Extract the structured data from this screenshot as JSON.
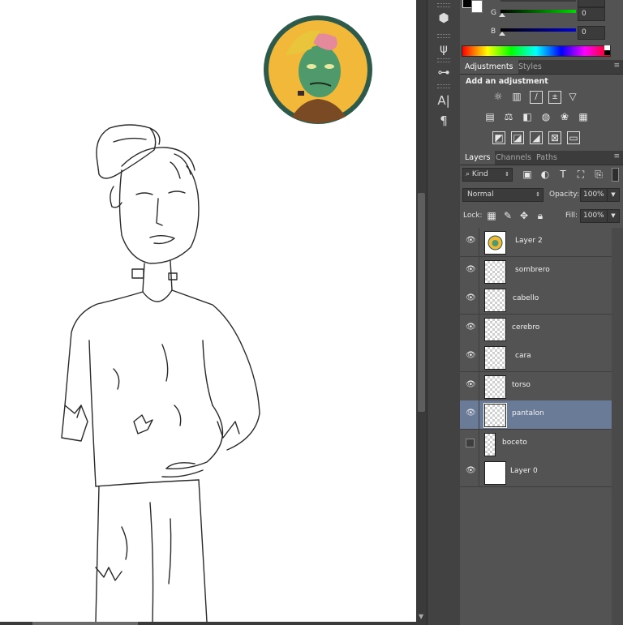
{
  "color_panel": {
    "g_label": "G",
    "g_value": "0",
    "b_label": "B",
    "b_value": "0",
    "g_color": "#00d800",
    "b_color": "#0000d8"
  },
  "adjustments": {
    "tab_adjustments": "Adjustments",
    "tab_styles": "Styles",
    "heading": "Add an adjustment",
    "icons": [
      "brightness-icon",
      "levels-icon",
      "curves-icon",
      "exposure-icon",
      "vibrance-icon",
      "hue-saturation-icon",
      "color-balance-icon",
      "black-white-icon",
      "photo-filter-icon",
      "channel-mixer-icon",
      "color-lookup-icon",
      "invert-icon",
      "posterize-icon",
      "threshold-icon",
      "selective-color-icon",
      "gradient-map-icon"
    ]
  },
  "layers_panel": {
    "tab_layers": "Layers",
    "tab_channels": "Channels",
    "tab_paths": "Paths",
    "filter_kind": "Kind",
    "blend_mode": "Normal",
    "opacity_label": "Opacity:",
    "opacity_value": "100%",
    "lock_label": "Lock:",
    "fill_label": "Fill:",
    "fill_value": "100%",
    "layers": [
      {
        "name": "Layer 2",
        "visible": true,
        "selected": false,
        "thumb": "image"
      },
      {
        "name": "sombrero",
        "visible": true,
        "selected": false,
        "thumb": "transparent"
      },
      {
        "name": "cabello",
        "visible": true,
        "selected": false,
        "thumb": "transparent"
      },
      {
        "name": "cerebro",
        "visible": true,
        "selected": false,
        "thumb": "transparent"
      },
      {
        "name": "cara",
        "visible": true,
        "selected": false,
        "thumb": "transparent"
      },
      {
        "name": "torso",
        "visible": true,
        "selected": false,
        "thumb": "transparent"
      },
      {
        "name": "pantalon",
        "visible": true,
        "selected": true,
        "thumb": "transparent"
      },
      {
        "name": "boceto",
        "visible": false,
        "selected": false,
        "thumb": "transparent"
      },
      {
        "name": "Layer 0",
        "visible": true,
        "selected": false,
        "thumb": "white"
      }
    ]
  },
  "toolstrip": {
    "icons": [
      "3d-icon",
      "brush-presets-icon",
      "clone-source-icon",
      "character-icon",
      "paragraph-icon"
    ],
    "character_glyph": "A|",
    "paragraph_glyph": "¶"
  },
  "colors": {
    "selection": "#6a7b98",
    "panel": "#535353",
    "sticker_bg": "#f2b83a",
    "sticker_ring": "#2d5a4a",
    "zombie_skin": "#4f9a6a",
    "hat": "#e8c53a",
    "brain": "#e58a9a"
  }
}
